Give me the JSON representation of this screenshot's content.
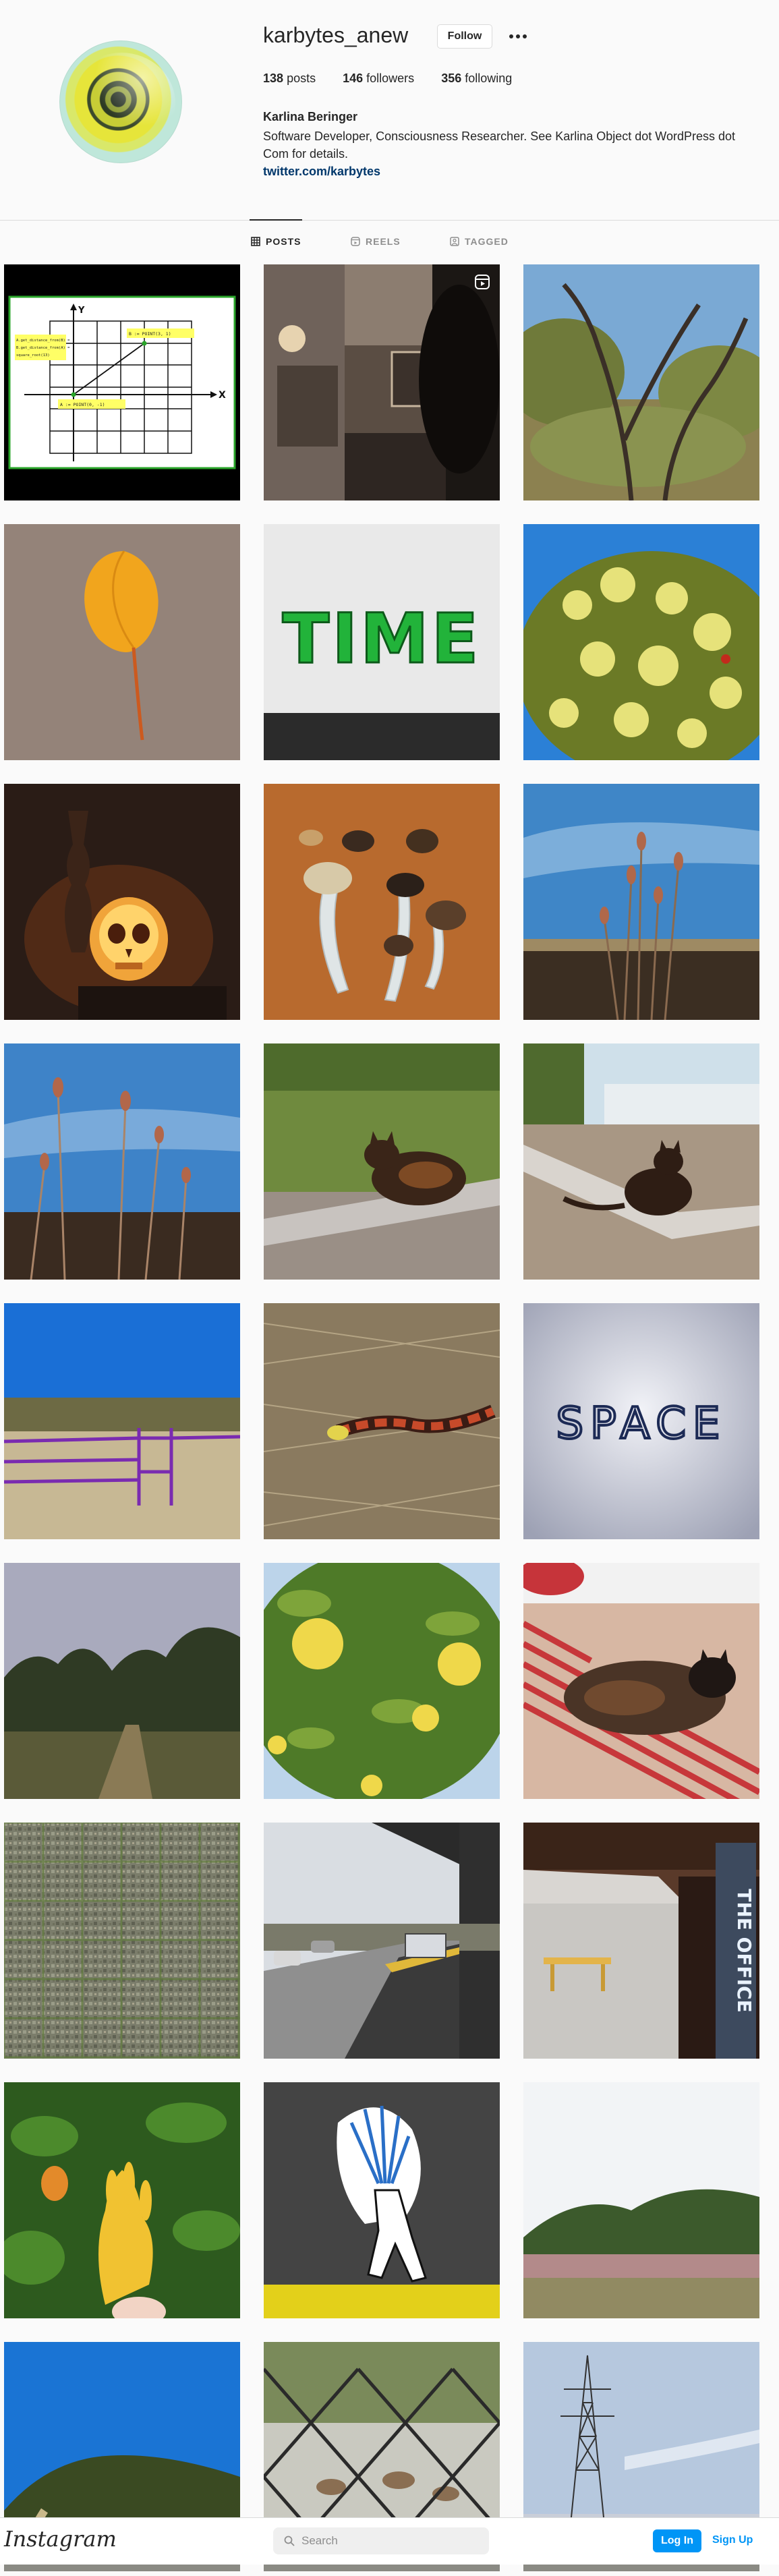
{
  "profile": {
    "username": "karbytes_anew",
    "follow_label": "Follow",
    "more_icon": "ellipsis-icon",
    "stats": {
      "posts_count": "138",
      "posts_label": "posts",
      "followers_count": "146",
      "followers_label": "followers",
      "following_count": "356",
      "following_label": "following"
    },
    "full_name": "Karlina Beringer",
    "bio": "Software Developer, Consciousness Researcher. See Karlina Object dot WordPress dot Com for details.",
    "link": "twitter.com/karbytes"
  },
  "tabs": [
    {
      "label": "POSTS",
      "icon": "grid-icon",
      "active": true
    },
    {
      "label": "REELS",
      "icon": "reels-icon",
      "active": false
    },
    {
      "label": "TAGGED",
      "icon": "tag-icon",
      "active": false
    }
  ],
  "posts": {
    "diagram_texts": {
      "y_axis": "Y",
      "x_axis": "X",
      "note_left": "A.get_distance_from(B) = B.get_distance_from(A) = square_root(13)",
      "label_b": "B := POINT(3, 1)",
      "label_a": "A := POINT(0, -1)"
    },
    "word_time": "TIME",
    "word_space": "SPACE",
    "office_sign": "THE OFFICE",
    "tiles": [
      "coordinate-diagram",
      "reel-dark-room",
      "oak-trees",
      "yellow-leaf",
      "time-word",
      "yellow-flowers-bush",
      "skull-lamp",
      "mushrooms",
      "teasel-sky-1",
      "teasel-sky-2",
      "cat-on-curb-1",
      "cat-on-curb-2",
      "purple-gate-hills",
      "snake-in-grass",
      "space-word",
      "dusk-trail",
      "lemon-tree",
      "cat-on-cushions",
      "noise-pattern",
      "train-platform",
      "office-building",
      "buddhas-hand-fruit",
      "sticker-on-post",
      "hills-meadow",
      "hillside-blue-sky",
      "deer-behind-fence",
      "power-tower-marsh"
    ]
  },
  "footer": {
    "logo": "Instagram",
    "search_placeholder": "Search",
    "login_label": "Log In",
    "signup_label": "Sign Up"
  },
  "colors": {
    "accent": "#0095f6",
    "link": "#00376b",
    "text": "#262626",
    "muted": "#8e8e8e",
    "background": "#fafafa"
  }
}
